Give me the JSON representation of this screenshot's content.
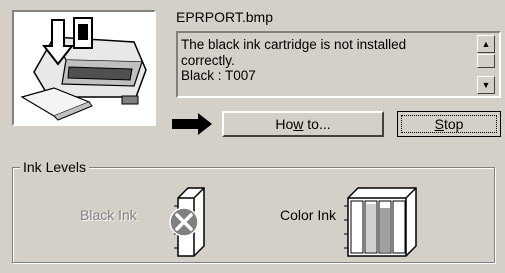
{
  "file_name": "EPRPORT.bmp",
  "message": "The black ink cartridge is not installed\ncorrectly.\nBlack : T007",
  "buttons": {
    "howto_pre": "Ho",
    "howto_u": "w",
    "howto_post": " to...",
    "stop_u": "S",
    "stop_post": "top"
  },
  "ink_levels": {
    "group_label": "Ink Levels",
    "black_label": "Black Ink",
    "color_label": "Color Ink",
    "black_status": "not installed"
  },
  "colors": {
    "background": "#d4d0c8",
    "error_icon": "#808080",
    "cyan_level": "#d0d0d0",
    "magenta_level": "#a0a0a0"
  }
}
